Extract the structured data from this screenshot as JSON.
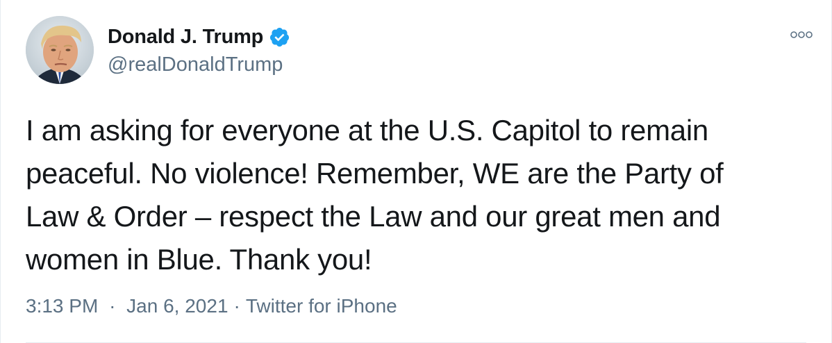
{
  "author": {
    "display_name": "Donald J. Trump",
    "handle": "@realDonaldTrump",
    "verified": true
  },
  "tweet": {
    "text": "I am asking for everyone at the U.S. Capitol to remain\npeaceful. No violence! Remember, WE are the Party of\nLaw & Order – respect the Law and our great men and\nwomen in Blue. Thank you!",
    "time": "3:13 PM",
    "date": "Jan 6, 2021",
    "source": "Twitter for iPhone",
    "separator": "·"
  },
  "icons": {
    "verified": "verified-badge-icon",
    "more": "more-options-icon"
  },
  "colors": {
    "accent": "#1da1f2",
    "text": "#14171a",
    "secondary": "#5b7083",
    "border": "#e6ecf0"
  }
}
